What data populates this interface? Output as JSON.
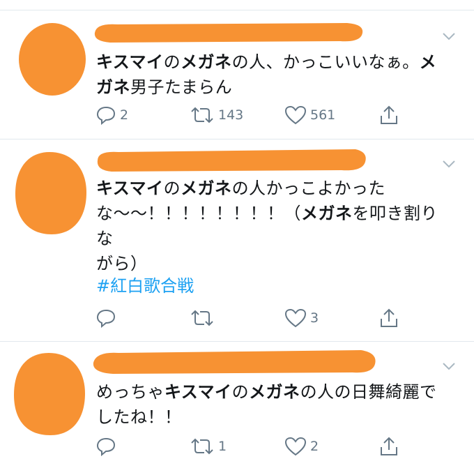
{
  "colors": {
    "scribble": "#fb923c",
    "icon": "#657786",
    "link": "#1da1f2",
    "border": "#e1e8ed"
  },
  "tweets": [
    {
      "lines": [
        [
          {
            "t": "キスマイ",
            "b": true
          },
          {
            "t": "の",
            "b": false
          },
          {
            "t": "メガネ",
            "b": true
          },
          {
            "t": "の人、かっこいいなぁ。",
            "b": false
          },
          {
            "t": "メ",
            "b": true
          }
        ],
        [
          {
            "t": "ガネ",
            "b": true
          },
          {
            "t": "男子たまらん",
            "b": false
          }
        ]
      ],
      "hashtag": "",
      "reply_count": "2",
      "retweet_count": "143",
      "like_count": "561"
    },
    {
      "lines": [
        [
          {
            "t": "キスマイ",
            "b": true
          },
          {
            "t": "の",
            "b": false
          },
          {
            "t": "メガネ",
            "b": true
          },
          {
            "t": "の人かっこよかった",
            "b": false
          }
        ],
        [
          {
            "t": "な〜〜！！！！！！！！（",
            "b": false
          },
          {
            "t": "メガネ",
            "b": true
          },
          {
            "t": "を叩き割りな",
            "b": false
          }
        ],
        [
          {
            "t": "がら）",
            "b": false
          }
        ]
      ],
      "hashtag": "#紅白歌合戦",
      "reply_count": "",
      "retweet_count": "",
      "like_count": "3"
    },
    {
      "lines": [
        [
          {
            "t": "めっちゃ",
            "b": false
          },
          {
            "t": "キスマイ",
            "b": true
          },
          {
            "t": "の",
            "b": false
          },
          {
            "t": "メガネ",
            "b": true
          },
          {
            "t": "の人の日舞綺麗で",
            "b": false
          }
        ],
        [
          {
            "t": "したね！！",
            "b": false
          }
        ]
      ],
      "hashtag": "",
      "reply_count": "",
      "retweet_count": "1",
      "like_count": "2"
    }
  ]
}
